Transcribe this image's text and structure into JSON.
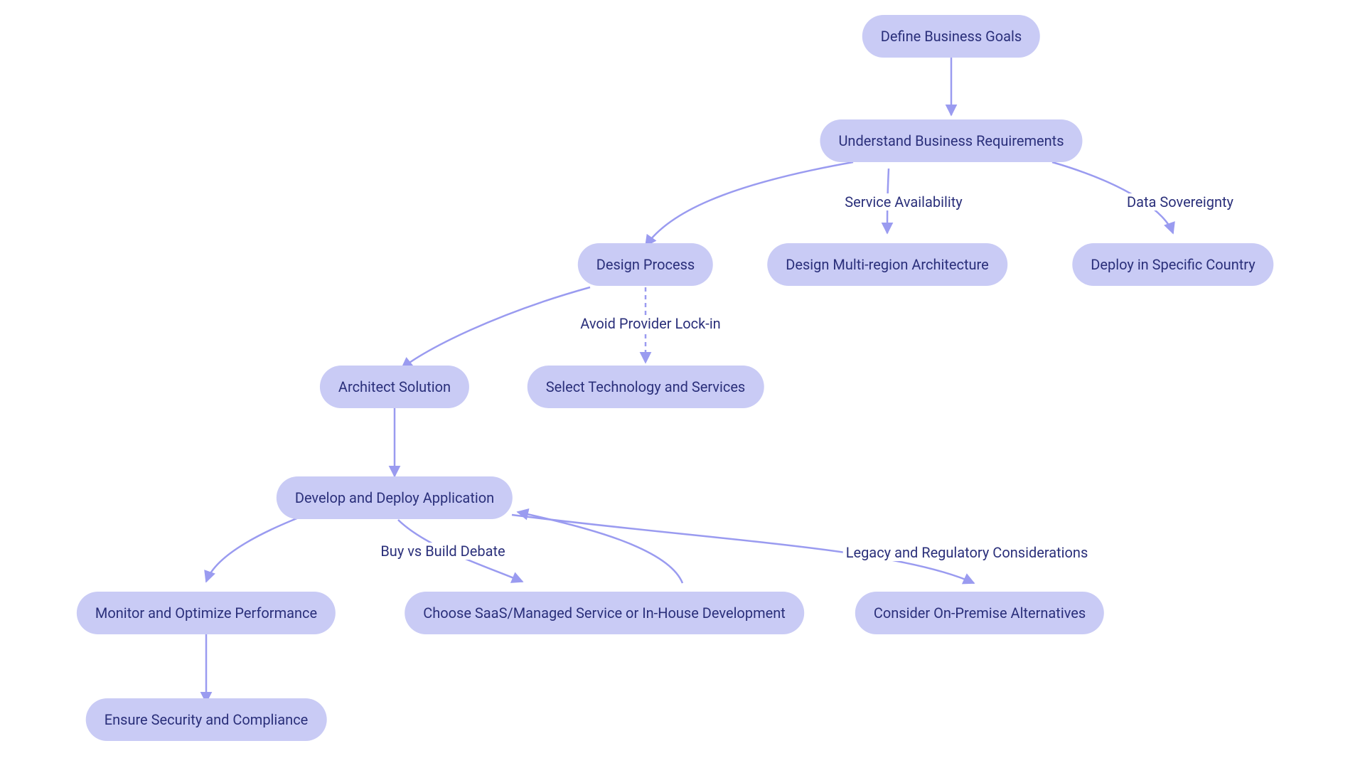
{
  "chart_data": {
    "type": "flowchart",
    "nodes": [
      {
        "id": "define",
        "label": "Define Business Goals"
      },
      {
        "id": "understand",
        "label": "Understand Business Requirements"
      },
      {
        "id": "design",
        "label": "Design Process"
      },
      {
        "id": "multiregion",
        "label": "Design Multi-region Architecture"
      },
      {
        "id": "country",
        "label": "Deploy in Specific Country"
      },
      {
        "id": "architect",
        "label": "Architect Solution"
      },
      {
        "id": "selecttech",
        "label": "Select Technology and Services"
      },
      {
        "id": "develop",
        "label": "Develop and Deploy Application"
      },
      {
        "id": "monitor",
        "label": "Monitor and Optimize Performance"
      },
      {
        "id": "saas",
        "label": "Choose SaaS/Managed Service or In-House Development"
      },
      {
        "id": "onprem",
        "label": "Consider On-Premise Alternatives"
      },
      {
        "id": "security",
        "label": "Ensure Security and Compliance"
      }
    ],
    "edge_labels": {
      "service_availability": "Service Availability",
      "data_sovereignty": "Data Sovereignty",
      "avoid_lockin": "Avoid Provider Lock-in",
      "buy_vs_build": "Buy vs Build Debate",
      "legacy_reg": "Legacy and Regulatory Considerations"
    },
    "edges": [
      {
        "from": "define",
        "to": "understand"
      },
      {
        "from": "understand",
        "to": "design"
      },
      {
        "from": "understand",
        "to": "multiregion",
        "label": "Service Availability"
      },
      {
        "from": "understand",
        "to": "country",
        "label": "Data Sovereignty"
      },
      {
        "from": "design",
        "to": "architect"
      },
      {
        "from": "design",
        "to": "selecttech",
        "label": "Avoid Provider Lock-in",
        "style": "dashed"
      },
      {
        "from": "architect",
        "to": "develop"
      },
      {
        "from": "develop",
        "to": "monitor"
      },
      {
        "from": "develop",
        "to": "saas",
        "label": "Buy vs Build Debate"
      },
      {
        "from": "develop",
        "to": "onprem",
        "label": "Legacy and Regulatory Considerations"
      },
      {
        "from": "saas",
        "to": "develop"
      },
      {
        "from": "monitor",
        "to": "security"
      }
    ]
  }
}
